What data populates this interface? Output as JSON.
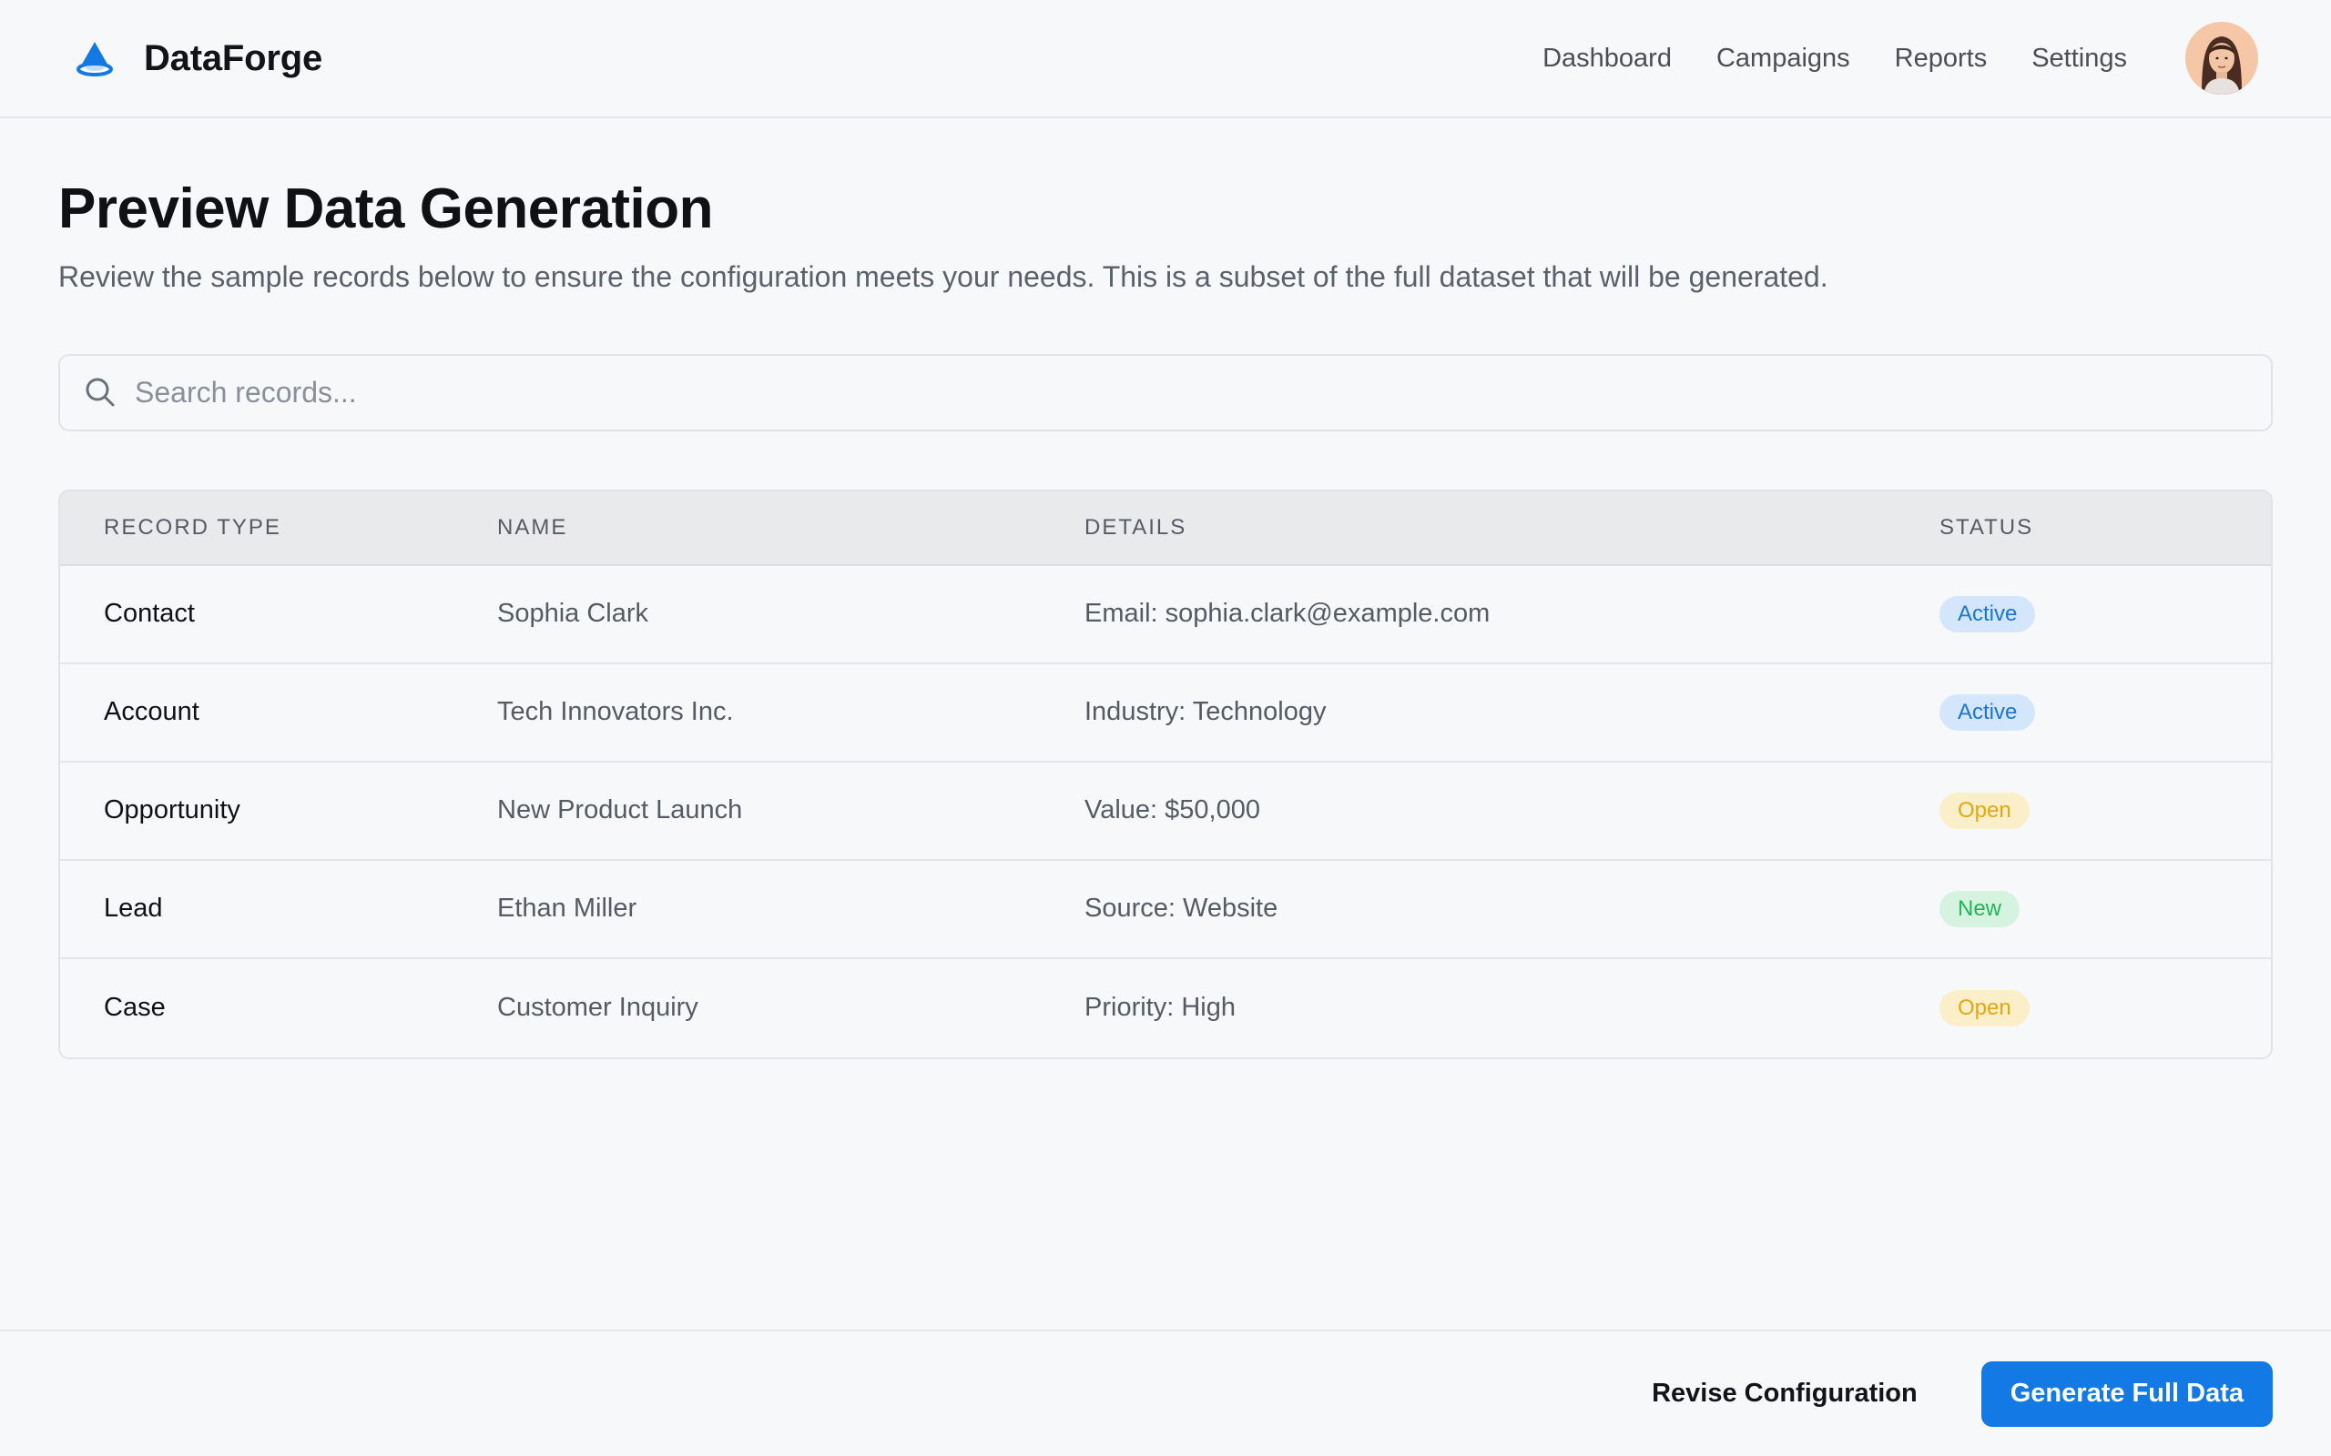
{
  "header": {
    "brand": "DataForge",
    "nav": [
      "Dashboard",
      "Campaigns",
      "Reports",
      "Settings"
    ]
  },
  "page": {
    "title": "Preview Data Generation",
    "subtitle": "Review the sample records below to ensure the configuration meets your needs. This is a subset of the full dataset that will be generated."
  },
  "search": {
    "placeholder": "Search records..."
  },
  "table": {
    "columns": [
      "Record Type",
      "Name",
      "Details",
      "Status"
    ],
    "rows": [
      {
        "type": "Contact",
        "name": "Sophia Clark",
        "details": "Email: sophia.clark@example.com",
        "status": "Active",
        "status_kind": "active"
      },
      {
        "type": "Account",
        "name": "Tech Innovators Inc.",
        "details": "Industry: Technology",
        "status": "Active",
        "status_kind": "active"
      },
      {
        "type": "Opportunity",
        "name": "New Product Launch",
        "details": "Value: $50,000",
        "status": "Open",
        "status_kind": "open"
      },
      {
        "type": "Lead",
        "name": "Ethan Miller",
        "details": "Source: Website",
        "status": "New",
        "status_kind": "new"
      },
      {
        "type": "Case",
        "name": "Customer Inquiry",
        "details": "Priority: High",
        "status": "Open",
        "status_kind": "open"
      }
    ]
  },
  "footer": {
    "secondary_label": "Revise Configuration",
    "primary_label": "Generate Full Data"
  },
  "colors": {
    "accent": "#1379e4",
    "active_bg": "#d4e6fb",
    "open_bg": "#fbefc9",
    "new_bg": "#d5f3df"
  },
  "icons": {
    "logo": "droplet-logo-icon",
    "search": "search-icon",
    "avatar": "user-avatar"
  }
}
